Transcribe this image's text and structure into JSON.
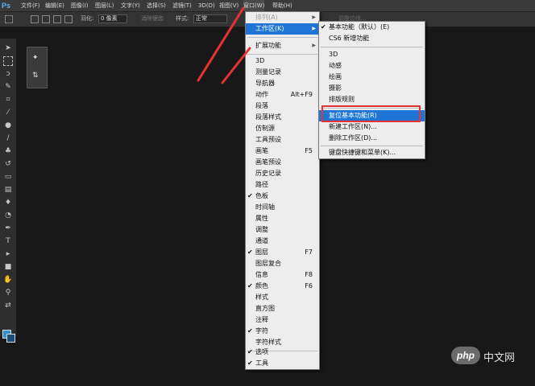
{
  "menubar": {
    "logo": "Ps",
    "items": [
      "文件(F)",
      "编辑(E)",
      "图像(I)",
      "图层(L)",
      "文字(Y)",
      "选择(S)",
      "滤镜(T)",
      "3D(D)",
      "视图(V)",
      "窗口(W)",
      "帮助(H)"
    ]
  },
  "options": {
    "feather_label": "羽化:",
    "feather_value": "0 像素",
    "antialias_label": "消除锯齿",
    "style_label": "样式:",
    "style_value": "正常",
    "width_label": "宽度:",
    "height_label": "高度:",
    "refine_label": "调整边缘..."
  },
  "window_menu": {
    "items": [
      {
        "label": "排列(A)",
        "disabled": true,
        "submenu": true
      },
      {
        "label": "工作区(K)",
        "submenu": true,
        "highlighted": true
      },
      {
        "label": "扩展功能",
        "submenu": true
      },
      {
        "label": "3D"
      },
      {
        "label": "测量记录"
      },
      {
        "label": "导航器"
      },
      {
        "label": "动作",
        "shortcut": "Alt+F9"
      },
      {
        "label": "段落"
      },
      {
        "label": "段落样式"
      },
      {
        "label": "仿制源"
      },
      {
        "label": "工具预设"
      },
      {
        "label": "画笔",
        "shortcut": "F5"
      },
      {
        "label": "画笔预设"
      },
      {
        "label": "历史记录"
      },
      {
        "label": "路径"
      },
      {
        "label": "色板",
        "checked": true
      },
      {
        "label": "时间轴"
      },
      {
        "label": "属性"
      },
      {
        "label": "调整"
      },
      {
        "label": "通道"
      },
      {
        "label": "图层",
        "shortcut": "F7",
        "checked": true
      },
      {
        "label": "图层复合"
      },
      {
        "label": "信息",
        "shortcut": "F8"
      },
      {
        "label": "颜色",
        "shortcut": "F6",
        "checked": true
      },
      {
        "label": "样式"
      },
      {
        "label": "直方图"
      },
      {
        "label": "注释"
      },
      {
        "label": "字符",
        "checked": true
      },
      {
        "label": "字符样式"
      },
      {
        "label": "选项",
        "checked": true
      },
      {
        "label": "工具",
        "checked": true
      }
    ]
  },
  "workspace_menu": {
    "items": [
      {
        "label": "基本功能（默认）(E)",
        "checked": true
      },
      {
        "label": "CS6 新增功能"
      },
      {
        "label": "3D"
      },
      {
        "label": "动感"
      },
      {
        "label": "绘画"
      },
      {
        "label": "摄影"
      },
      {
        "label": "排版规则"
      },
      {
        "label": "复位基本功能(R)",
        "highlighted": true
      },
      {
        "label": "新建工作区(N)..."
      },
      {
        "label": "删除工作区(D)..."
      },
      {
        "label": "键盘快捷键和菜单(K)..."
      }
    ]
  },
  "watermark": {
    "badge": "php",
    "text": "中文网"
  },
  "colors": {
    "highlight": "#1e75d6",
    "annotation": "#e63232",
    "foreground_swatch": "#2f8fd0"
  }
}
